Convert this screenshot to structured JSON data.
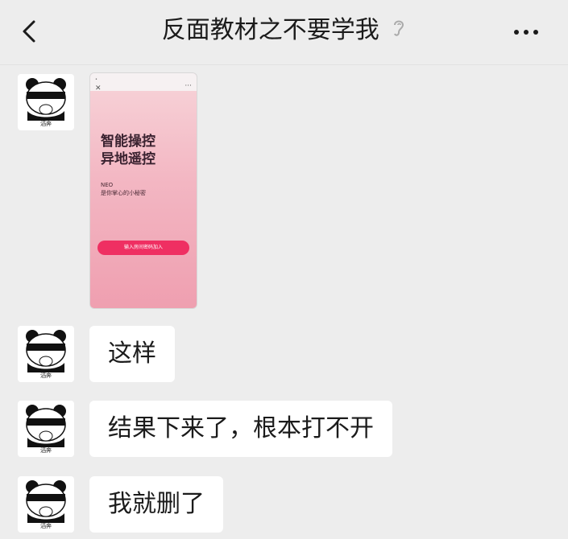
{
  "header": {
    "title": "反面教材之不要学我",
    "icons": {
      "back": "back-arrow-icon",
      "muted": "ear-icon",
      "more": "more-icon"
    }
  },
  "avatar_caption": "滔奔",
  "messages": [
    {
      "type": "image",
      "image": {
        "headline_1": "智能操控",
        "headline_2": "异地遥控",
        "brand": "NEO",
        "tagline": "是你掌心的小秘密",
        "cta": "输入房间密码加入"
      }
    },
    {
      "type": "text",
      "text": "这样"
    },
    {
      "type": "text",
      "text": "结果下来了，根本打不开"
    },
    {
      "type": "text",
      "text": "我就删了"
    }
  ],
  "colors": {
    "background": "#ededed",
    "bubble": "#ffffff",
    "cta": "#ef2f62"
  }
}
